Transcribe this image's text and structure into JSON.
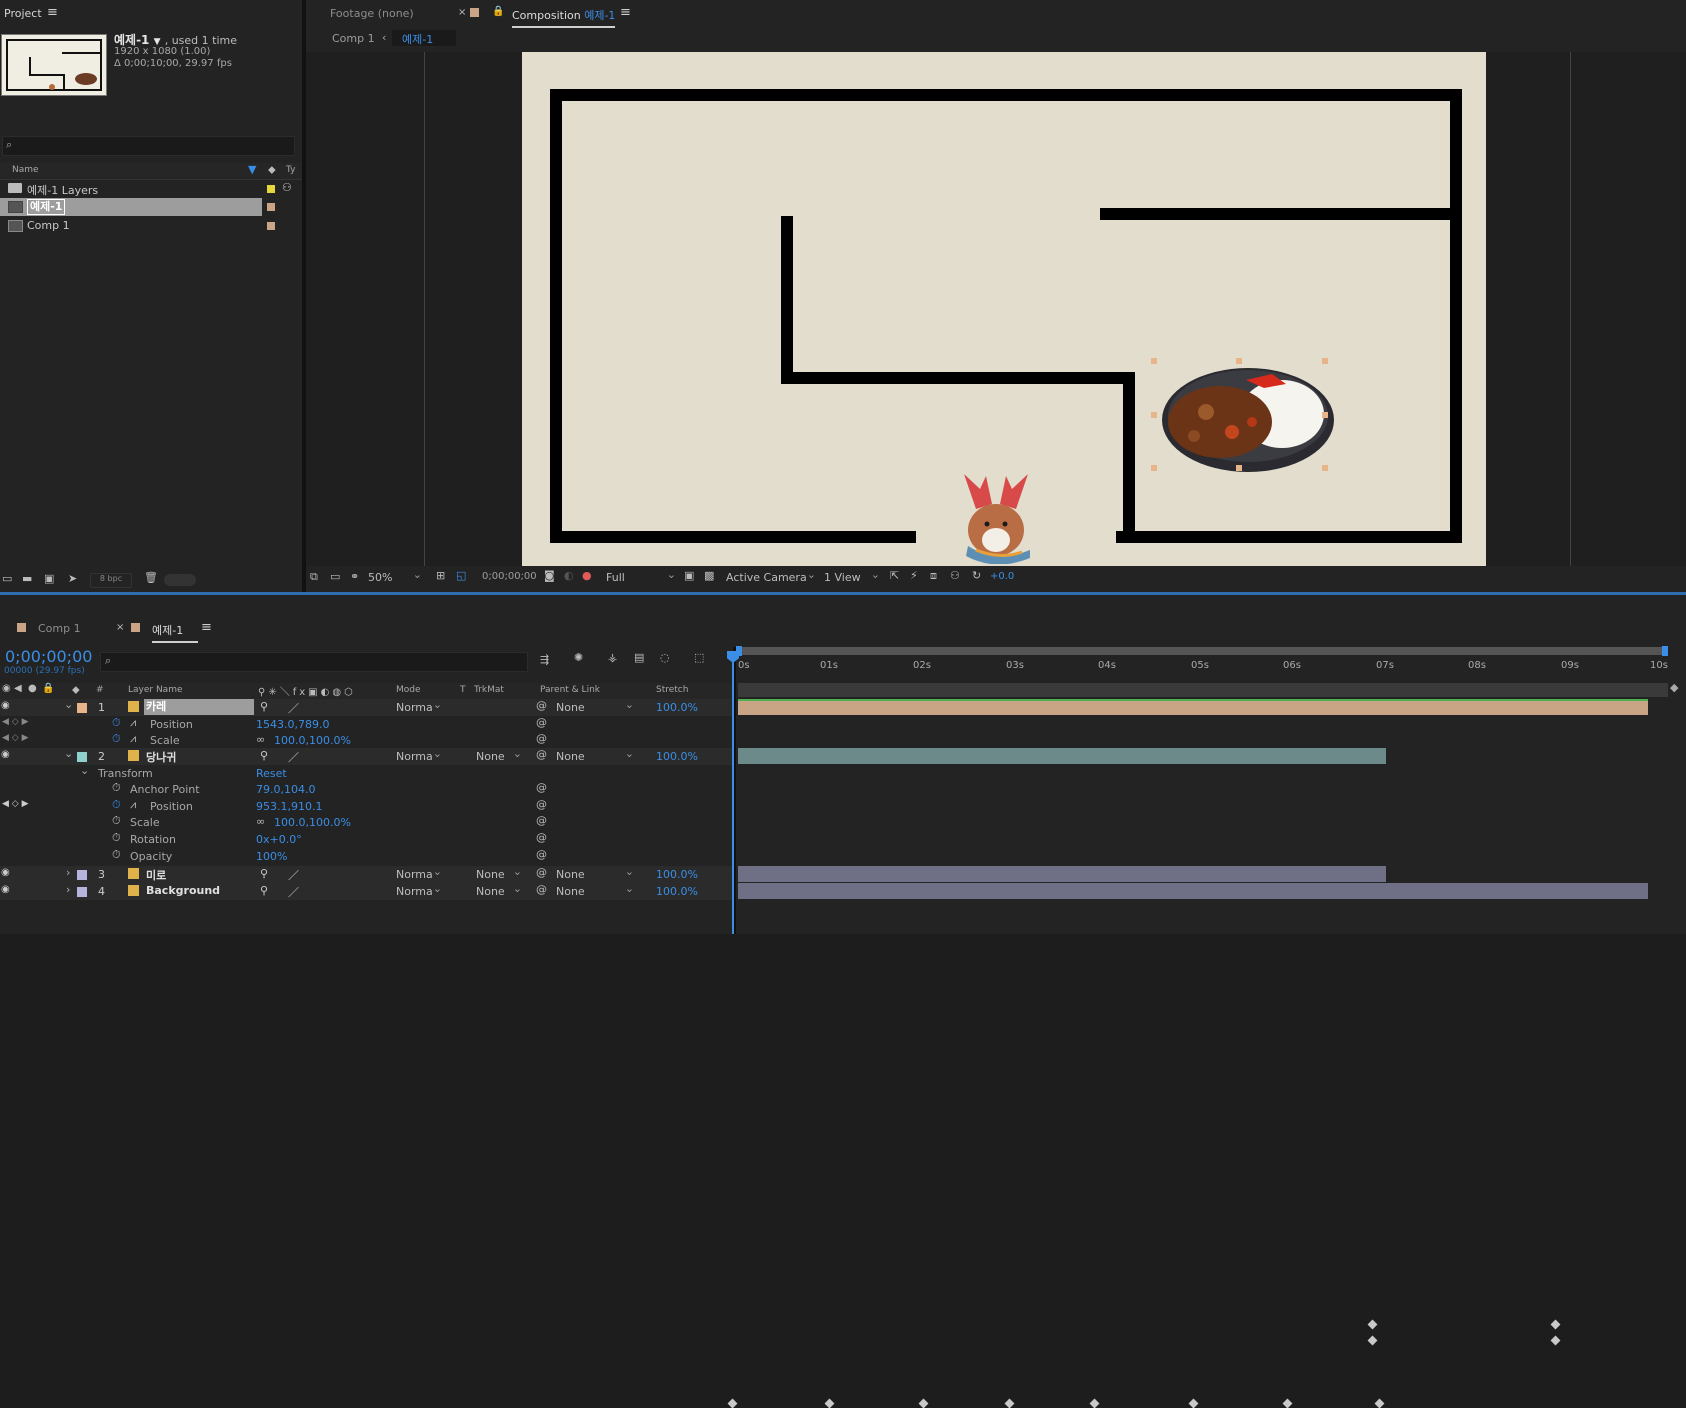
{
  "project": {
    "panel_title": "Project",
    "comp_name": "예제-1",
    "used": ", used 1 time",
    "resolution": "1920 x 1080 (1.00)",
    "duration": "Δ 0;00;10;00, 29.97 fps",
    "col_name": "Name",
    "col_type": "Ty",
    "items": [
      {
        "label": "예제-1 Layers"
      },
      {
        "label": "예제-1"
      },
      {
        "label": "Comp 1"
      }
    ],
    "bpc": "8 bpc"
  },
  "viewer": {
    "footage_tab": "Footage (none)",
    "comp_tab_prefix": "Composition",
    "comp_tab_name": "예제-1",
    "crumb_1": "Comp 1",
    "crumb_2": "예제-1",
    "zoom": "50%",
    "timecode": "0;00;00;00",
    "resolution": "Full",
    "camera": "Active Camera",
    "views": "1 View",
    "exposure": "+0.0"
  },
  "timeline": {
    "tab_1": "Comp 1",
    "tab_2": "예제-1",
    "timecode": "0;00;00;00",
    "frame_info": "00000 (29.97 fps)",
    "col_num": "#",
    "col_layer_name": "Layer Name",
    "col_mode": "Mode",
    "col_t": "T",
    "col_trkmat": "TrkMat",
    "col_parent": "Parent & Link",
    "col_stretch": "Stretch",
    "ruler": [
      "0s",
      "01s",
      "02s",
      "03s",
      "04s",
      "05s",
      "06s",
      "07s",
      "08s",
      "09s",
      "10s"
    ],
    "layers": [
      {
        "num": "1",
        "name": "카레",
        "mode": "Norma",
        "parent": "None",
        "stretch": "100.0%"
      },
      {
        "num": "2",
        "name": "당나귀",
        "mode": "Norma",
        "trkmat": "None",
        "parent": "None",
        "stretch": "100.0%"
      },
      {
        "num": "3",
        "name": "미로",
        "mode": "Norma",
        "trkmat": "None",
        "parent": "None",
        "stretch": "100.0%"
      },
      {
        "num": "4",
        "name": "Background",
        "mode": "Norma",
        "trkmat": "None",
        "parent": "None",
        "stretch": "100.0%"
      }
    ],
    "l1_props": [
      {
        "name": "Position",
        "value": "1543.0,789.0"
      },
      {
        "name": "Scale",
        "value": "100.0,100.0%"
      }
    ],
    "transform_label": "Transform",
    "reset_label": "Reset",
    "l2_props": [
      {
        "name": "Anchor Point",
        "value": "79.0,104.0"
      },
      {
        "name": "Position",
        "value": "953.1,910.1"
      },
      {
        "name": "Scale",
        "value": "100.0,100.0%"
      },
      {
        "name": "Rotation",
        "value": "0x+0.0°"
      },
      {
        "name": "Opacity",
        "value": "100%"
      }
    ]
  },
  "colors": {
    "accent": "#3a8ee6",
    "canvas": "#e2ddcc",
    "layer1_bar": "#c9a585",
    "layer2_bar": "#6d8a8a",
    "layer3_bar": "#6f6f86",
    "layer4_bar": "#6f6f86"
  }
}
